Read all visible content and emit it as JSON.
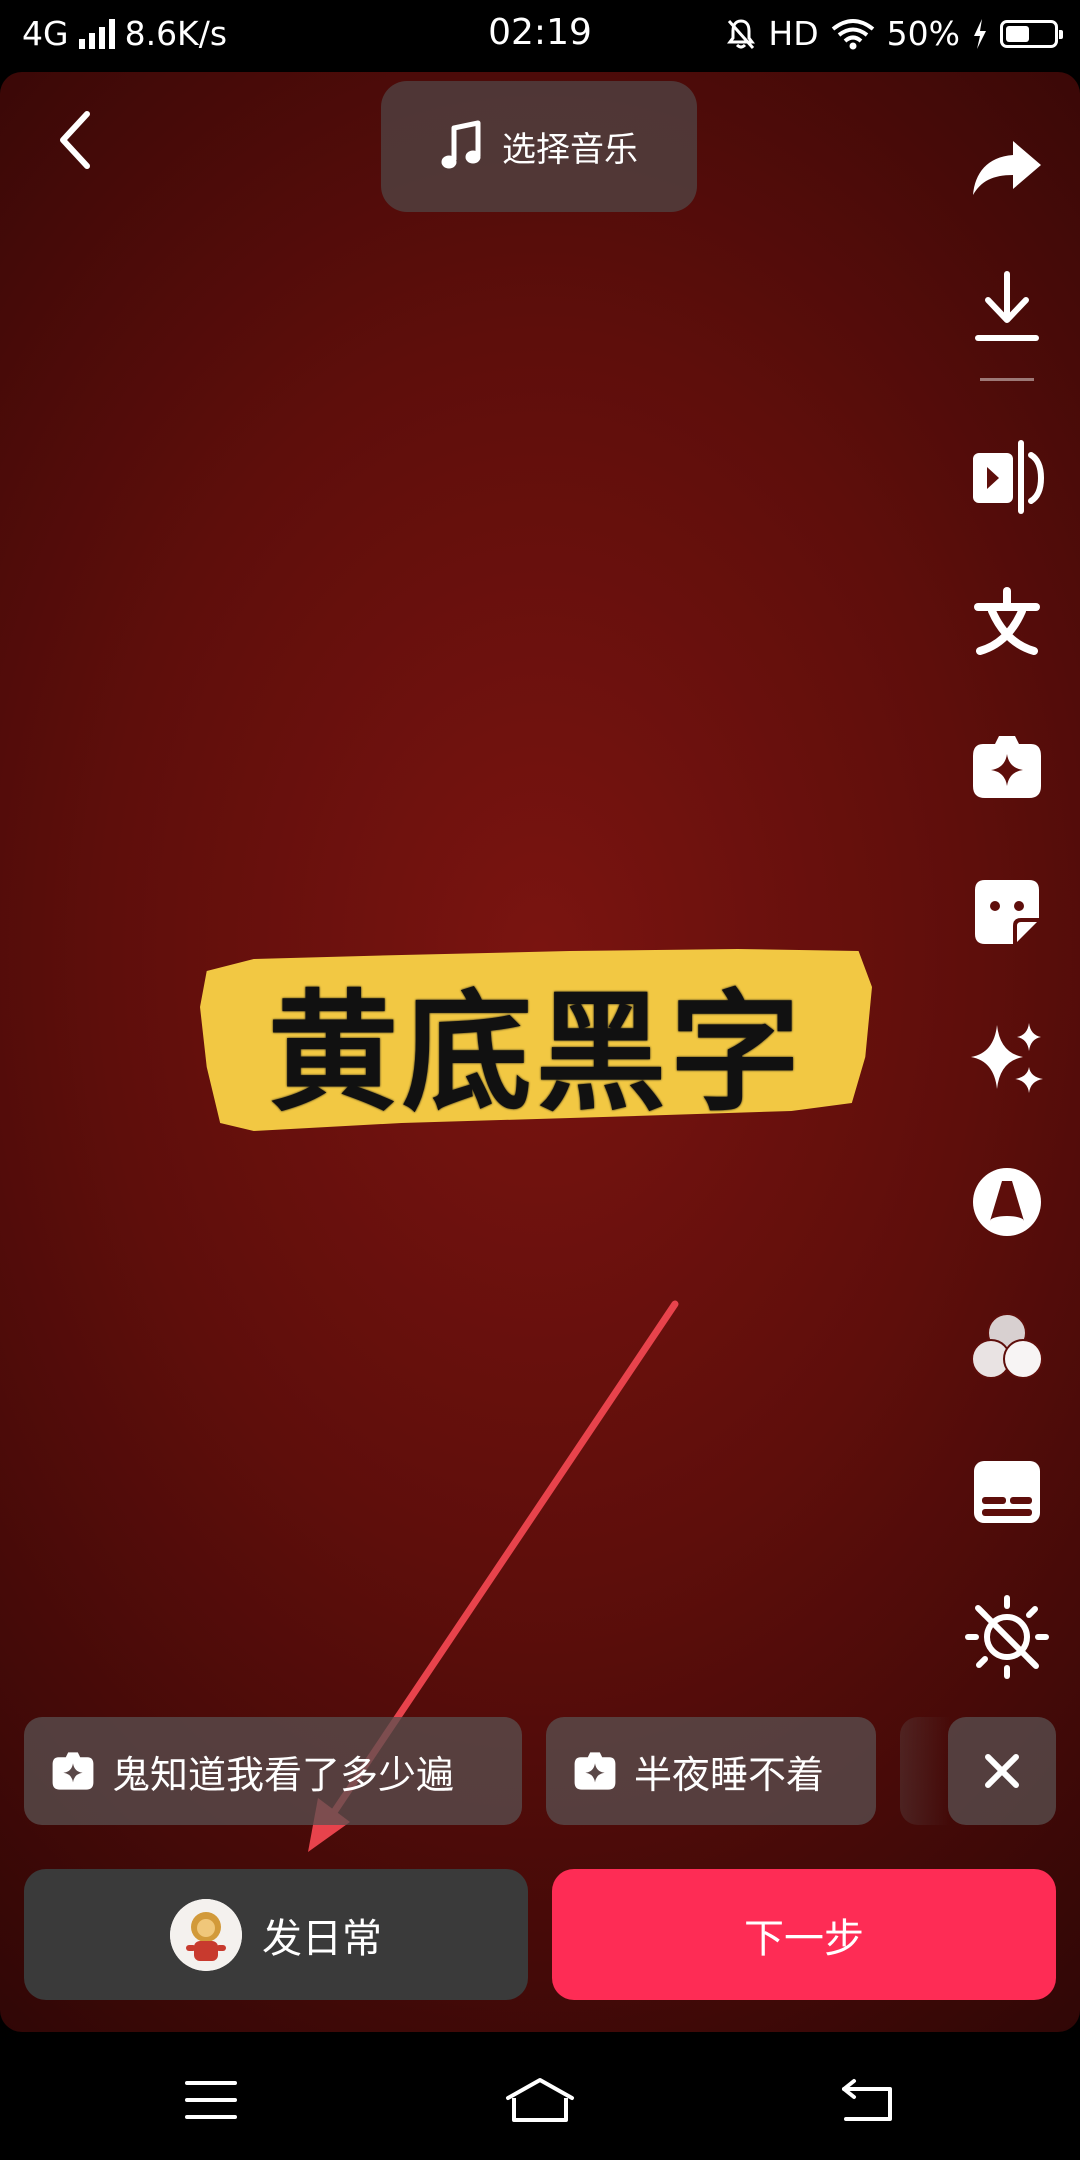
{
  "status_bar": {
    "network": "4G",
    "speed": "8.6K/s",
    "time": "02:19",
    "hd": "HD",
    "battery": "50%",
    "battery_level": 0.5
  },
  "header": {
    "music_label": "选择音乐"
  },
  "toolbar": {
    "icons": [
      "share-icon",
      "download-icon",
      "clip-icon",
      "text-icon",
      "effects-icon",
      "sticker-icon",
      "sparkle-icon",
      "filter-icon",
      "color-icon",
      "subtitle-icon",
      "enhance-off-icon"
    ]
  },
  "sticker": {
    "text": "黄底黑字",
    "color": "#f2c843"
  },
  "chips": [
    {
      "label": "鬼知道我看了多少遍"
    },
    {
      "label": "半夜睡不着"
    }
  ],
  "actions": {
    "daily_label": "发日常",
    "next_label": "下一步",
    "next_color": "#fe2c55"
  },
  "annotation": {
    "arrow_color": "#e8434c"
  }
}
